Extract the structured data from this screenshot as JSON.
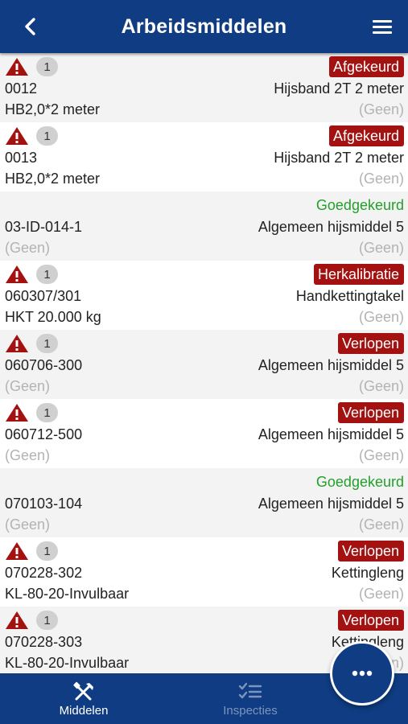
{
  "header": {
    "title": "Arbeidsmiddelen",
    "back_icon": "chevron-left-icon",
    "menu_icon": "hamburger-menu-icon"
  },
  "items": [
    {
      "warning": true,
      "count": "1",
      "status": "Afgekeurd",
      "status_kind": "badge",
      "code": "0012",
      "name": "Hijsband 2T 2 meter",
      "detail": "HB2,0*2 meter",
      "extra": "(Geen)"
    },
    {
      "warning": true,
      "count": "1",
      "status": "Afgekeurd",
      "status_kind": "badge",
      "code": "0013",
      "name": "Hijsband 2T 2 meter",
      "detail": "HB2,0*2 meter",
      "extra": "(Geen)"
    },
    {
      "warning": false,
      "count": "",
      "status": "Goedgekeurd",
      "status_kind": "green",
      "code": "03-ID-014-1",
      "name": "Algemeen hijsmiddel 5",
      "detail": "(Geen)",
      "extra": "(Geen)"
    },
    {
      "warning": true,
      "count": "1",
      "status": "Herkalibratie",
      "status_kind": "badge",
      "code": "060307/301",
      "name": "Handkettingtakel",
      "detail": "HKT 20.000 kg",
      "extra": "(Geen)"
    },
    {
      "warning": true,
      "count": "1",
      "status": "Verlopen",
      "status_kind": "badge",
      "code": "060706-300",
      "name": "Algemeen hijsmiddel 5",
      "detail": "(Geen)",
      "extra": "(Geen)"
    },
    {
      "warning": true,
      "count": "1",
      "status": "Verlopen",
      "status_kind": "badge",
      "code": "060712-500",
      "name": "Algemeen hijsmiddel 5",
      "detail": "(Geen)",
      "extra": "(Geen)"
    },
    {
      "warning": false,
      "count": "",
      "status": "Goedgekeurd",
      "status_kind": "green",
      "code": "070103-104",
      "name": "Algemeen hijsmiddel 5",
      "detail": "(Geen)",
      "extra": "(Geen)"
    },
    {
      "warning": true,
      "count": "1",
      "status": "Verlopen",
      "status_kind": "badge",
      "code": "070228-302",
      "name": "Kettingleng",
      "detail": "KL-80-20-Invulbaar",
      "extra": "(Geen)"
    },
    {
      "warning": true,
      "count": "1",
      "status": "Verlopen",
      "status_kind": "badge",
      "code": "070228-303",
      "name": "Kettingleng",
      "detail": "KL-80-20-Invulbaar",
      "extra": "(Geen)"
    }
  ],
  "bottom_nav": {
    "middelen": {
      "label": "Middelen",
      "icon": "tools-icon"
    },
    "inspecties": {
      "label": "Inspecties",
      "icon": "checklist-icon"
    }
  },
  "fab": {
    "icon": "more-dots-icon"
  },
  "colors": {
    "primary": "#0f3c82",
    "badge_red": "#a31111",
    "approved_green": "#23a02b",
    "muted": "#b3b3b3"
  }
}
